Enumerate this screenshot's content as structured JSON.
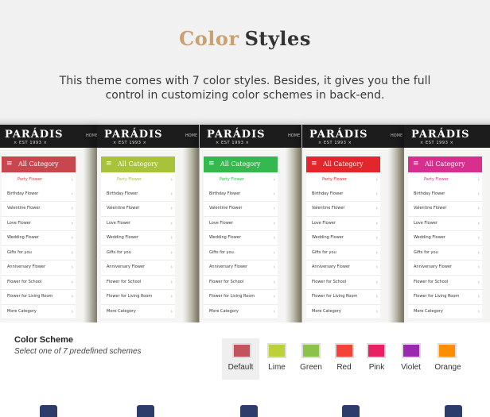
{
  "heading": {
    "word1": "Color",
    "word2": "Styles"
  },
  "description": {
    "line1": "This theme comes with 7 color styles. Besides, it gives you the full",
    "line2": "control in customizing color schemes in back-end."
  },
  "preview": {
    "logo": "PARÁDIS",
    "est": "× EST 1993 ×",
    "nav_label": "HOME",
    "category_title": "All Category",
    "menu_icon": "menu-icon",
    "arrow_icon": "chevron-right-icon",
    "arrow_glyph": "›",
    "menu_glyph": "≡",
    "items": [
      "Party Flower",
      "Birthday Flower",
      "Valentine Flower",
      "Love Flower",
      "Wedding Flower",
      "Gifts for you",
      "Anniversary Flower",
      "Flower for School",
      "Flower for Living Room",
      "More Category"
    ],
    "variants": [
      {
        "name": "Default",
        "color": "#c8464e"
      },
      {
        "name": "Lime",
        "color": "#a8c23a"
      },
      {
        "name": "Green",
        "color": "#35b94f"
      },
      {
        "name": "Red",
        "color": "#e2262c"
      },
      {
        "name": "Pink",
        "color": "#d62f8e"
      }
    ]
  },
  "color_scheme": {
    "title": "Color Scheme",
    "subtitle": "Select one of 7 predefined schemes",
    "selected": "Default",
    "options": [
      {
        "label": "Default",
        "color": "#c4545c"
      },
      {
        "label": "Lime",
        "color": "#bdd03a"
      },
      {
        "label": "Green",
        "color": "#8bc34a"
      },
      {
        "label": "Red",
        "color": "#f44336"
      },
      {
        "label": "Pink",
        "color": "#e91e63"
      },
      {
        "label": "Violet",
        "color": "#9c27b0"
      },
      {
        "label": "Orange",
        "color": "#ff8f00"
      }
    ]
  }
}
